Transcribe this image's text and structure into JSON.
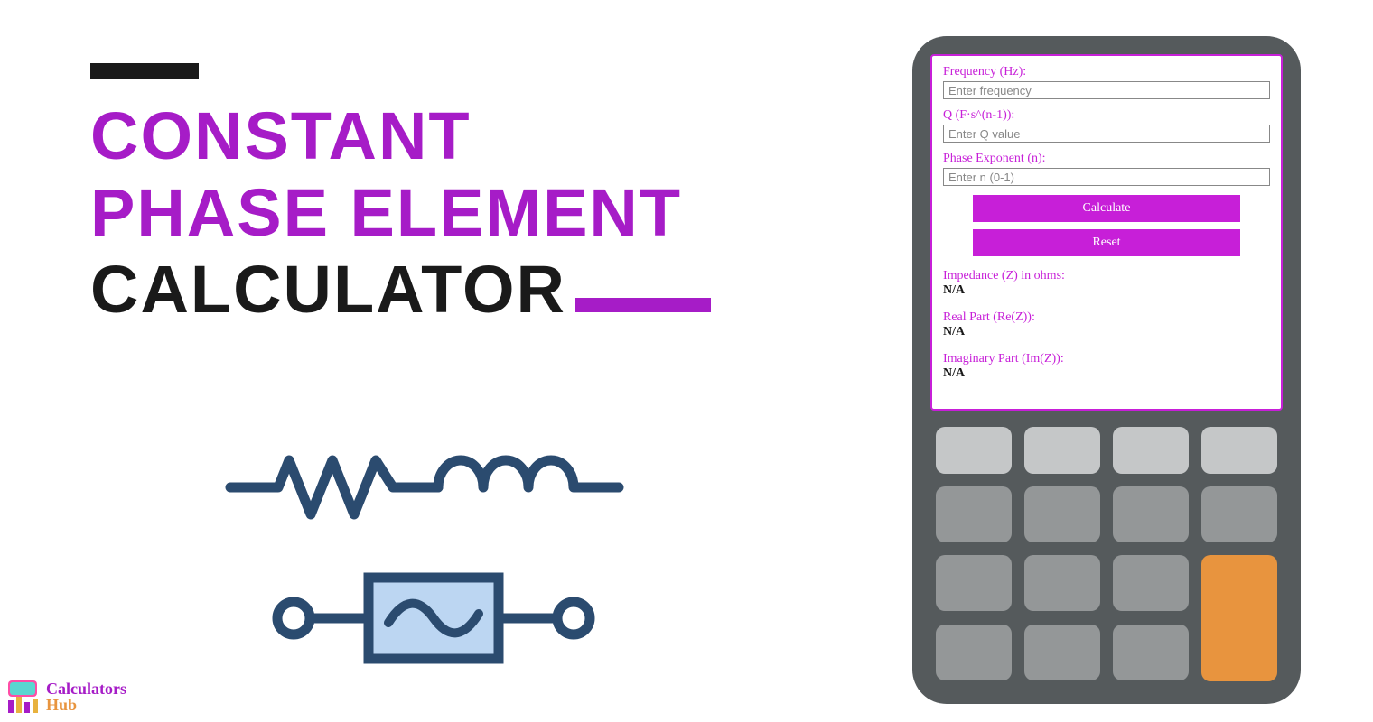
{
  "title": {
    "line1": "CONSTANT",
    "line2": "PHASE ELEMENT",
    "line3": "CALCULATOR"
  },
  "form": {
    "frequency": {
      "label": "Frequency (Hz):",
      "placeholder": "Enter frequency",
      "value": ""
    },
    "q": {
      "label": "Q (F·s^(n-1)):",
      "placeholder": "Enter Q value",
      "value": ""
    },
    "n": {
      "label": "Phase Exponent (n):",
      "placeholder": "Enter n (0-1)",
      "value": ""
    },
    "calculate": "Calculate",
    "reset": "Reset"
  },
  "results": {
    "impedance": {
      "label": "Impedance (Z) in ohms:",
      "value": "N/A"
    },
    "real": {
      "label": "Real Part (Re(Z)):",
      "value": "N/A"
    },
    "imag": {
      "label": "Imaginary Part (Im(Z)):",
      "value": "N/A"
    }
  },
  "logo": {
    "line1": "Calculators",
    "line2": "Hub"
  },
  "colors": {
    "purple": "#a61cc7",
    "magenta": "#c71fd8",
    "orange": "#e8943e",
    "navy": "#2b4b6f",
    "grayDark": "#555a5c",
    "grayKey": "#949798",
    "grayLight": "#c5c7c8"
  }
}
